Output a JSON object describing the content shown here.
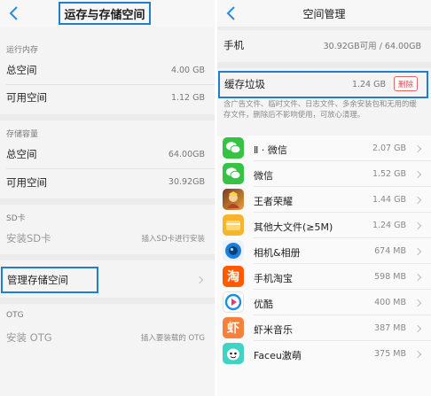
{
  "left": {
    "title": "运存与存储空间",
    "ram": {
      "section": "运行内存",
      "total_label": "总空间",
      "total_value": "4.00 GB",
      "avail_label": "可用空间",
      "avail_value": "1.12 GB"
    },
    "storage": {
      "section": "存储容量",
      "total_label": "总空间",
      "total_value": "64.00GB",
      "avail_label": "可用空间",
      "avail_value": "30.92GB"
    },
    "sd": {
      "section": "SD卡",
      "install_label": "安装SD卡",
      "install_hint": "插入SD卡进行安装"
    },
    "manage": {
      "label": "管理存储空间"
    },
    "otg": {
      "section": "OTG",
      "install_label": "安装 OTG",
      "install_hint": "插入要装载的 OTG"
    }
  },
  "right": {
    "title": "空间管理",
    "phone": {
      "label": "手机",
      "value": "30.92GB可用 / 64.00GB"
    },
    "cache": {
      "label": "缓存垃圾",
      "value": "1.24 GB",
      "delete_label": "删除"
    },
    "description": "含广告文件、临时文件、日志文件、多余安装包和无用的缓存文件，删除后不影响使用，可放心清理。",
    "apps": [
      {
        "name": "Ⅱ · 微信",
        "size": "2.07 GB",
        "icon": "wechat-icon",
        "color": "#35c245"
      },
      {
        "name": "微信",
        "size": "1.52 GB",
        "icon": "wechat-icon",
        "color": "#35c245"
      },
      {
        "name": "王者荣耀",
        "size": "1.44 GB",
        "icon": "honor-of-kings-icon",
        "color": "#c8762a"
      },
      {
        "name": "其他大文件(≥5M)",
        "size": "1.24 GB",
        "icon": "folder-icon",
        "color": "#f7b52c"
      },
      {
        "name": "相机&相册",
        "size": "674 MB",
        "icon": "camera-icon",
        "color": "#1d7fd9"
      },
      {
        "name": "手机淘宝",
        "size": "598 MB",
        "icon": "taobao-icon",
        "color": "#ff5a00"
      },
      {
        "name": "优酷",
        "size": "400 MB",
        "icon": "youku-icon",
        "color": "#1e8fe0"
      },
      {
        "name": "虾米音乐",
        "size": "387 MB",
        "icon": "xiami-music-icon",
        "color": "#f7813a"
      },
      {
        "name": "Faceu激萌",
        "size": "375 MB",
        "icon": "faceu-icon",
        "color": "#3fd3c4"
      }
    ]
  }
}
